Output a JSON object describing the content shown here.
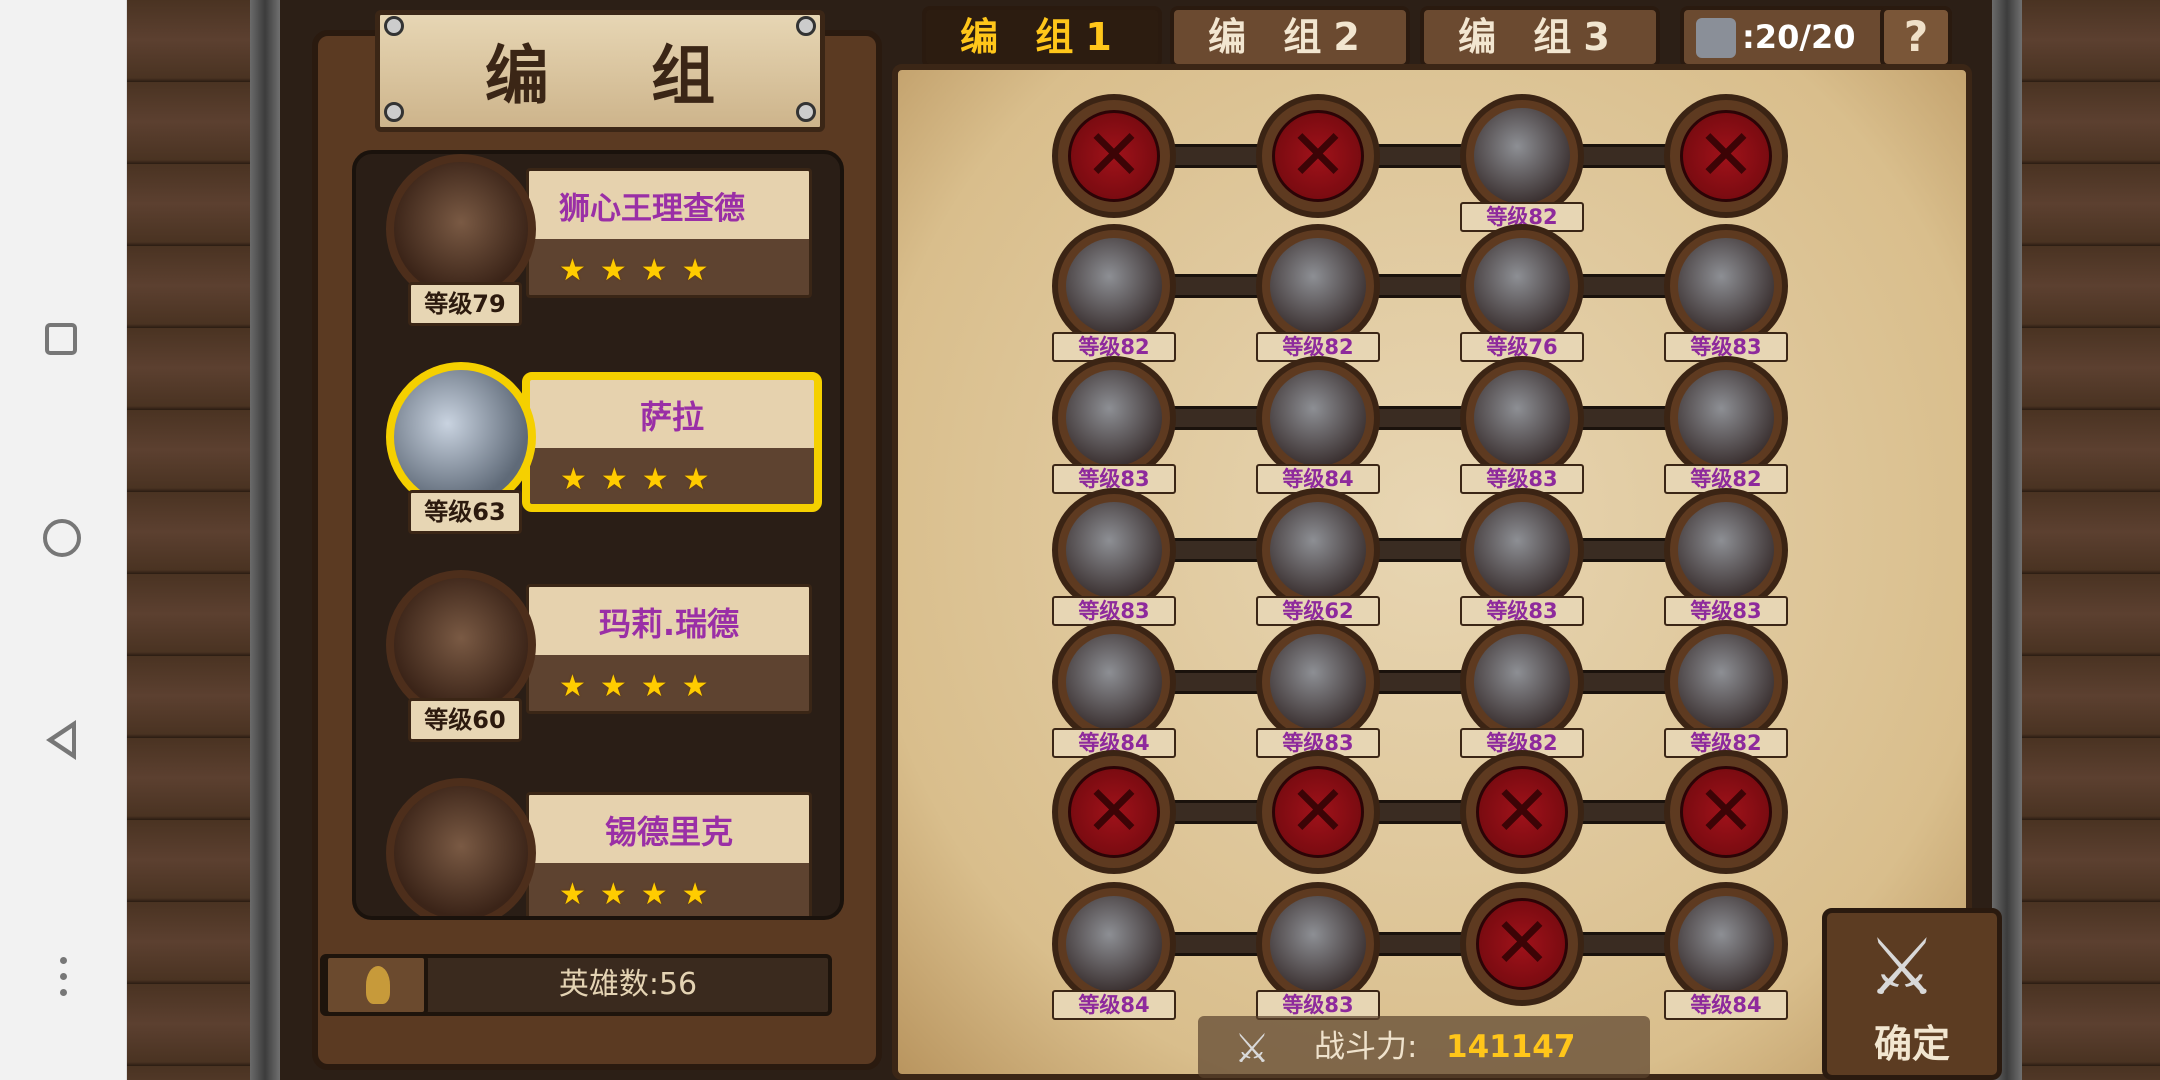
{
  "title": "编 组",
  "tabs": [
    {
      "label": "编 组1",
      "active": true
    },
    {
      "label": "编 组2",
      "active": false
    },
    {
      "label": "编 组3",
      "active": false
    }
  ],
  "resource": {
    "text": ":20/20",
    "icon": "unit-icon"
  },
  "help": "?",
  "heroes": [
    {
      "name": "狮心王理查德",
      "stars": "★★★★",
      "level": "等级79",
      "selected": false
    },
    {
      "name": "萨拉",
      "stars": "★★★★",
      "level": "等级63",
      "selected": true
    },
    {
      "name": "玛莉.瑞德",
      "stars": "★★★★",
      "level": "等级60",
      "selected": false
    },
    {
      "name": "锡德里克",
      "stars": "★★★★",
      "level": "",
      "selected": false
    }
  ],
  "hero_count": "英雄数:56",
  "grid": [
    [
      {
        "empty": true
      },
      {
        "empty": true
      },
      {
        "level": "等级82"
      },
      {
        "empty": true
      }
    ],
    [
      {
        "level": "等级82"
      },
      {
        "level": "等级82"
      },
      {
        "level": "等级76"
      },
      {
        "level": "等级83"
      }
    ],
    [
      {
        "level": "等级83"
      },
      {
        "level": "等级84"
      },
      {
        "level": "等级83"
      },
      {
        "level": "等级82"
      }
    ],
    [
      {
        "level": "等级83"
      },
      {
        "level": "等级62"
      },
      {
        "level": "等级83"
      },
      {
        "level": "等级83"
      }
    ],
    [
      {
        "level": "等级84"
      },
      {
        "level": "等级83"
      },
      {
        "level": "等级82"
      },
      {
        "level": "等级82"
      }
    ],
    [
      {
        "empty": true
      },
      {
        "empty": true
      },
      {
        "empty": true
      },
      {
        "empty": true
      }
    ],
    [
      {
        "level": "等级84"
      },
      {
        "level": "等级83"
      },
      {
        "empty": true
      },
      {
        "level": "等级84"
      }
    ]
  ],
  "power": {
    "label": "战斗力:",
    "value": "141147"
  },
  "confirm": "确定"
}
